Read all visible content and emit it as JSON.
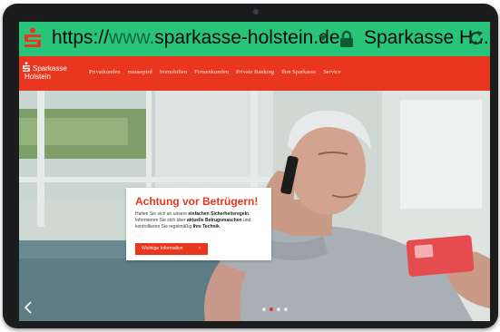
{
  "browser": {
    "url_scheme": "https://",
    "url_subdomain": "www.",
    "url_domain": "sparkasse-holstein.de",
    "site_identity": "Sparkasse H...",
    "icons": [
      "sparkasse-logo-icon",
      "dropdown-icon",
      "lock-icon",
      "reload-icon"
    ]
  },
  "header": {
    "brand_line1": "Sparkasse",
    "brand_line2": "Holstein",
    "nav": [
      "Privatkunden",
      "mausepird",
      "Immobilien",
      "Firmenkunden",
      "Private Banking",
      "Ihre Sparkasse",
      "Service"
    ]
  },
  "hero": {
    "dialog": {
      "title": "Achtung vor Betrügern!",
      "body_1": "Halten Sie sich an unsere ",
      "body_2": "einfachen Sicherheitsregeln",
      "body_3": ". Informieren Sie sich über ",
      "body_4": "aktuelle Betrugsmaschen",
      "body_5": " und kontrollieren Sie regelmäßig ",
      "body_6": "Ihre Technik",
      "body_7": ".",
      "button_label": "Wichtige Information",
      "button_arrow": "›"
    },
    "carousel": {
      "slide_count": 4,
      "active_index": 1
    }
  },
  "colors": {
    "accent": "#e8361f",
    "addressbar": "#27c47a"
  }
}
